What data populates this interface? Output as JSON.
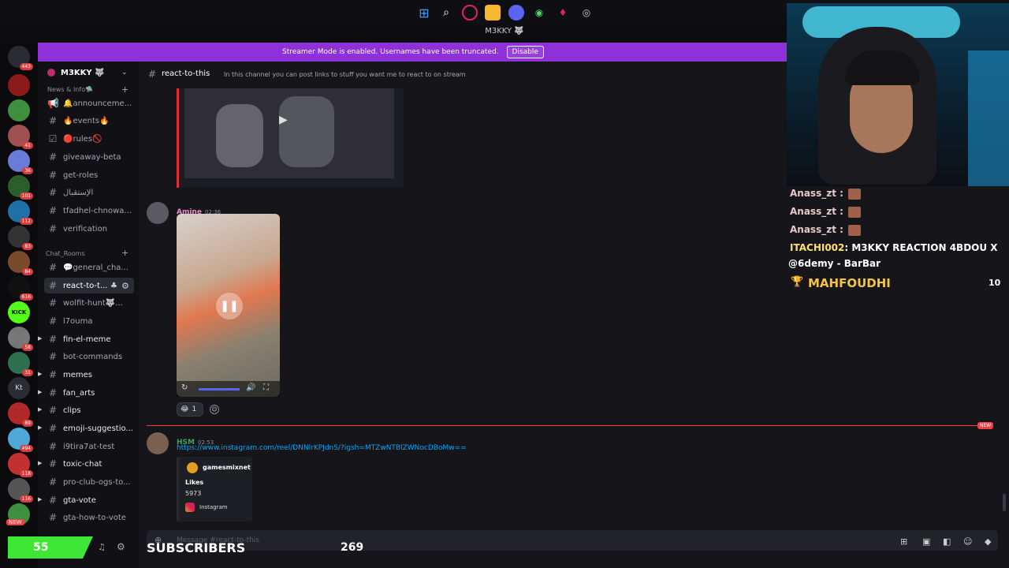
{
  "window": {
    "title": "M3KKY 🐺"
  },
  "banner": {
    "text": "Streamer Mode is enabled. Usernames have been truncated.",
    "button": "Disable"
  },
  "rail": {
    "badges": [
      "443",
      "41",
      "36",
      "101",
      "112",
      "83",
      "84",
      "616",
      "58",
      "31",
      "89",
      "494",
      "118",
      "116"
    ],
    "labels": {
      "kick": "KICK",
      "kt": "Kt",
      "new": "NEW"
    }
  },
  "guild": {
    "name": "M3KKY 🐺"
  },
  "categories": {
    "news": "News & Info🛸",
    "chat": "Chat_Rooms"
  },
  "channels": [
    {
      "icon": "📢",
      "label": "🔔announceme..."
    },
    {
      "icon": "#",
      "label": "🔥events🔥"
    },
    {
      "icon": "☑",
      "label": "🔴rules🚫"
    },
    {
      "icon": "#",
      "label": "giveaway-beta"
    },
    {
      "icon": "#",
      "label": "get-roles"
    },
    {
      "icon": "#",
      "label": "الإستقبال"
    },
    {
      "icon": "#",
      "label": "tfadhel-chnowa..."
    },
    {
      "icon": "#",
      "label": "verification"
    },
    {
      "icon": "#",
      "label": "💬general_cha..."
    },
    {
      "icon": "#",
      "label": "react-to-t..."
    },
    {
      "icon": "#",
      "label": "wolfit-hunt🐺..."
    },
    {
      "icon": "#",
      "label": "l7ouma"
    },
    {
      "icon": "#",
      "label": "fin-el-meme"
    },
    {
      "icon": "#",
      "label": "bot-commands"
    },
    {
      "icon": "#",
      "label": "memes"
    },
    {
      "icon": "#",
      "label": "fan_arts"
    },
    {
      "icon": "#",
      "label": "clips"
    },
    {
      "icon": "#",
      "label": "emoji-suggestio..."
    },
    {
      "icon": "#",
      "label": "i9tira7at-test"
    },
    {
      "icon": "#",
      "label": "toxic-chat"
    },
    {
      "icon": "#",
      "label": "pro-club-ogs-to..."
    },
    {
      "icon": "#",
      "label": "gta-vote"
    },
    {
      "icon": "#",
      "label": "gta-how-to-vote"
    }
  ],
  "header": {
    "channel": "react-to-this",
    "topic": "In this channel you can post links to stuff you want me to react to on stream"
  },
  "messages": [
    {
      "author": "Amine",
      "time": "02:36",
      "reaction_count": "1"
    },
    {
      "author": "HSM",
      "time": "02:53",
      "link": "https://www.instagram.com/reel/DNNlrKPJdnS/?igsh=MTZwNTBlZWNocDBoMw==",
      "embed": {
        "account": "gamesmixnet",
        "field": "Likes",
        "value": "5973",
        "provider": "Instagram"
      }
    }
  ],
  "new_marker": "NEW",
  "composer": {
    "placeholder": "Message #react-to-this"
  },
  "overlay": {
    "chat": [
      {
        "user": "Anass_zt :",
        "text": ""
      },
      {
        "user": "Anass_zt :",
        "text": ""
      },
      {
        "user": "Anass_zt :",
        "text": ""
      },
      {
        "user": "ITACHI002",
        "text": ": M3KKY REACTION 4BDOU X"
      },
      {
        "user": "",
        "text": "@6demy - BarBar"
      }
    ],
    "top": {
      "name": "MAHFOUDHI",
      "score": "10"
    },
    "subs": {
      "count": "55",
      "label": "SUBSCRIBERS",
      "goal": "269"
    }
  },
  "colors": {
    "banner": "#8e31d8",
    "amine": "#e48fd0",
    "hsm": "#3ba55c",
    "link": "#00a8fc",
    "new": "#f23f43"
  }
}
